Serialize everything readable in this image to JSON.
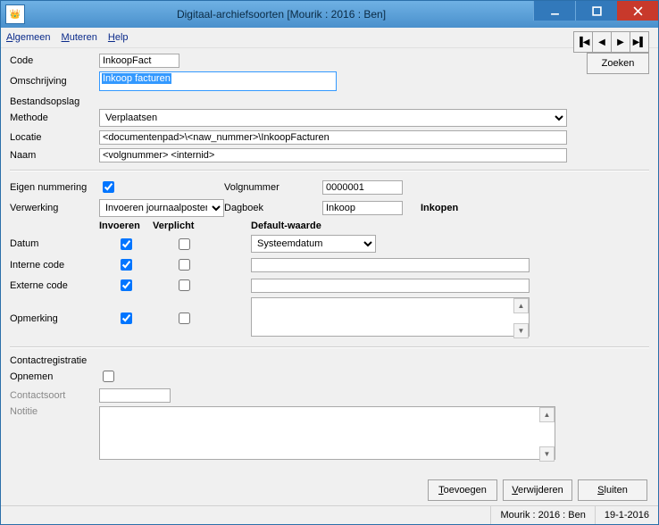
{
  "window": {
    "title": "Digitaal-archiefsoorten  [Mourik : 2016 : Ben]"
  },
  "menu": {
    "algemeen": "Algemeen",
    "muteren": "Muteren",
    "help": "Help"
  },
  "labels": {
    "code": "Code",
    "omschrijving": "Omschrijving",
    "bestandsopslag": "Bestandsopslag",
    "methode": "Methode",
    "locatie": "Locatie",
    "naam": "Naam",
    "eigen_nummering": "Eigen nummering",
    "volgnummer": "Volgnummer",
    "verwerking": "Verwerking",
    "dagboek": "Dagboek",
    "invoeren": "Invoeren",
    "verplicht": "Verplicht",
    "default_waarde": "Default-waarde",
    "datum": "Datum",
    "interne_code": "Interne code",
    "externe_code": "Externe code",
    "opmerking": "Opmerking",
    "contactregistratie": "Contactregistratie",
    "opnemen": "Opnemen",
    "contactsoort": "Contactsoort",
    "notitie": "Notitie"
  },
  "fields": {
    "code": "InkoopFact",
    "omschrijving": "Inkoop facturen",
    "methode": "Verplaatsen",
    "locatie": "<documentenpad>\\<naw_nummer>\\InkoopFacturen",
    "naam": "<volgnummer> <internid>",
    "eigen_nummering": true,
    "volgnummer": "0000001",
    "verwerking": "Invoeren journaalposten",
    "dagboek_code": "Inkoop",
    "dagboek_naam": "Inkopen",
    "datum_invoeren": true,
    "datum_verplicht": false,
    "datum_default": "Systeemdatum",
    "ic_invoeren": true,
    "ic_verplicht": false,
    "ic_default": "",
    "ec_invoeren": true,
    "ec_verplicht": false,
    "ec_default": "",
    "op_invoeren": true,
    "op_verplicht": false,
    "op_default": "",
    "opnemen": false,
    "contactsoort": "",
    "notitie": ""
  },
  "buttons": {
    "zoeken": "Zoeken",
    "toevoegen": "Toevoegen",
    "verwijderen": "Verwijderen",
    "sluiten": "Sluiten"
  },
  "status": {
    "context": "Mourik : 2016 : Ben",
    "date": "19-1-2016"
  }
}
